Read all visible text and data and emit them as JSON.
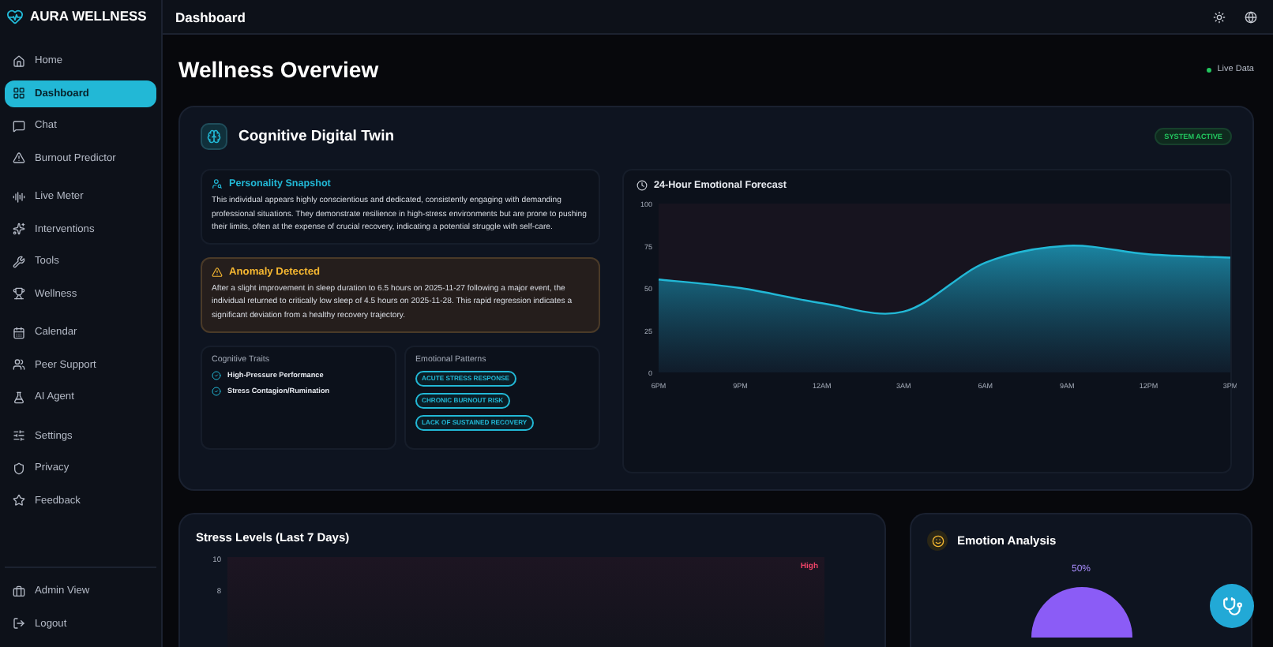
{
  "brand": {
    "name": "AURA WELLNESS"
  },
  "sidebar": {
    "groups": [
      {
        "items": [
          {
            "label": "Home",
            "selected": false
          },
          {
            "label": "Dashboard",
            "selected": true
          },
          {
            "label": "Chat",
            "selected": false
          },
          {
            "label": "Burnout Predictor",
            "selected": false
          }
        ]
      },
      {
        "items": [
          {
            "label": "Live Meter",
            "selected": false
          },
          {
            "label": "Interventions",
            "selected": false
          },
          {
            "label": "Tools",
            "selected": false
          },
          {
            "label": "Wellness",
            "selected": false
          }
        ]
      },
      {
        "items": [
          {
            "label": "Calendar",
            "selected": false
          },
          {
            "label": "Peer Support",
            "selected": false
          },
          {
            "label": "AI Agent",
            "selected": false
          }
        ]
      },
      {
        "items": [
          {
            "label": "Settings",
            "selected": false
          },
          {
            "label": "Privacy",
            "selected": false
          },
          {
            "label": "Feedback",
            "selected": false
          }
        ]
      }
    ],
    "footer": [
      {
        "label": "Admin View"
      },
      {
        "label": "Logout"
      }
    ]
  },
  "header": {
    "title": "Dashboard"
  },
  "page": {
    "title": "Wellness Overview",
    "live_status": "Live Data"
  },
  "twin": {
    "title": "Cognitive Digital Twin",
    "status": "SYSTEM ACTIVE",
    "snapshot": {
      "title": "Personality Snapshot",
      "text": "This individual appears highly conscientious and dedicated, consistently engaging with demanding professional situations. They demonstrate resilience in high-stress environments but are prone to pushing their limits, often at the expense of crucial recovery, indicating a potential struggle with self-care."
    },
    "anomaly": {
      "title": "Anomaly Detected",
      "text": "After a slight improvement in sleep duration to 6.5 hours on 2025-11-27 following a major event, the individual returned to critically low sleep of 4.5 hours on 2025-11-28. This rapid regression indicates a significant deviation from a healthy recovery trajectory."
    },
    "traits": {
      "title": "Cognitive Traits",
      "items": [
        "High-Pressure Performance",
        "Stress Contagion/Rumination"
      ]
    },
    "patterns": {
      "title": "Emotional Patterns",
      "items": [
        "ACUTE STRESS RESPONSE",
        "CHRONIC BURNOUT RISK",
        "LACK OF SUSTAINED RECOVERY"
      ]
    },
    "forecast": {
      "title": "24-Hour Emotional Forecast",
      "chart_data": {
        "type": "area",
        "categories": [
          "6PM",
          "9PM",
          "12AM",
          "3AM",
          "6AM",
          "9AM",
          "12PM",
          "3PM"
        ],
        "series": [
          {
            "color": "#22b8d6",
            "values": [
              55,
              50,
              41,
              36,
              65,
              75,
              70,
              68
            ]
          }
        ],
        "ylim": [
          0,
          100
        ],
        "yticks": [
          0,
          25,
          50,
          75,
          100
        ]
      }
    }
  },
  "stress": {
    "title": "Stress Levels (Last 7 Days)",
    "yticks": [
      "10",
      "8"
    ],
    "band_label": "High"
  },
  "emotion": {
    "title": "Emotion Analysis",
    "share": "50%"
  }
}
